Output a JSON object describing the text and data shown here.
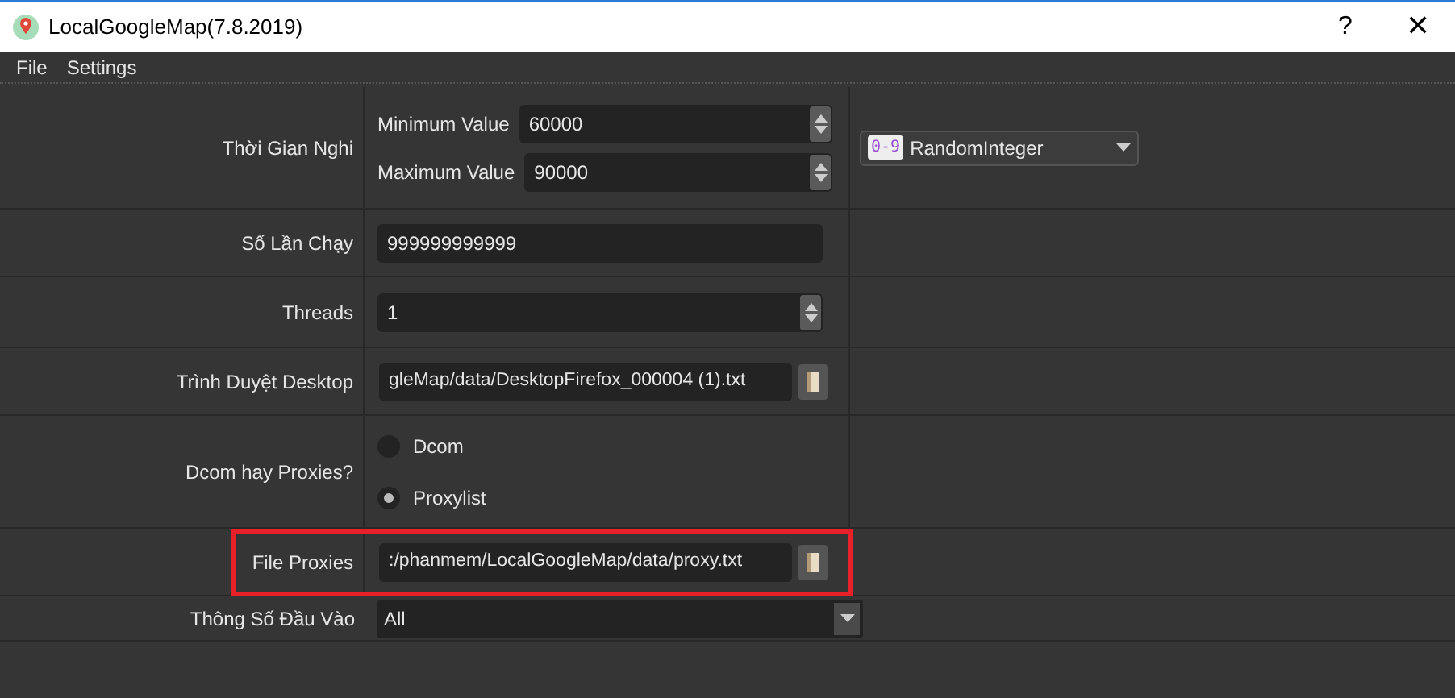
{
  "window": {
    "title": "LocalGoogleMap(7.8.2019)",
    "buttons": [
      "?",
      "✕"
    ]
  },
  "menu": [
    "File",
    "Settings"
  ],
  "rows": [
    {
      "kind": "range",
      "label": "Thời Gian Nghi",
      "fields": [
        {
          "label": "Minimum Value",
          "value": "60000"
        },
        {
          "label": "Maximum Value",
          "value": "90000"
        }
      ],
      "generator": {
        "badge": "0-9",
        "value": "RandomInteger"
      }
    },
    {
      "kind": "text",
      "label": "Số Lần Chạy",
      "value": "999999999999"
    },
    {
      "kind": "spin",
      "label": "Threads",
      "value": "1"
    },
    {
      "kind": "file",
      "label": "Trình Duyệt Desktop",
      "value": "gleMap/data/DesktopFirefox_000004 (1).txt"
    },
    {
      "kind": "radio",
      "label": "Dcom hay Proxies?",
      "options": [
        {
          "label": "Dcom",
          "selected": false
        },
        {
          "label": "Proxylist",
          "selected": true
        }
      ]
    },
    {
      "kind": "file",
      "label": "File Proxies",
      "value": ":/phanmem/LocalGoogleMap/data/proxy.txt",
      "highlighted": true
    },
    {
      "kind": "combo",
      "label": "Thông Số Đầu Vào",
      "value": "All"
    }
  ]
}
